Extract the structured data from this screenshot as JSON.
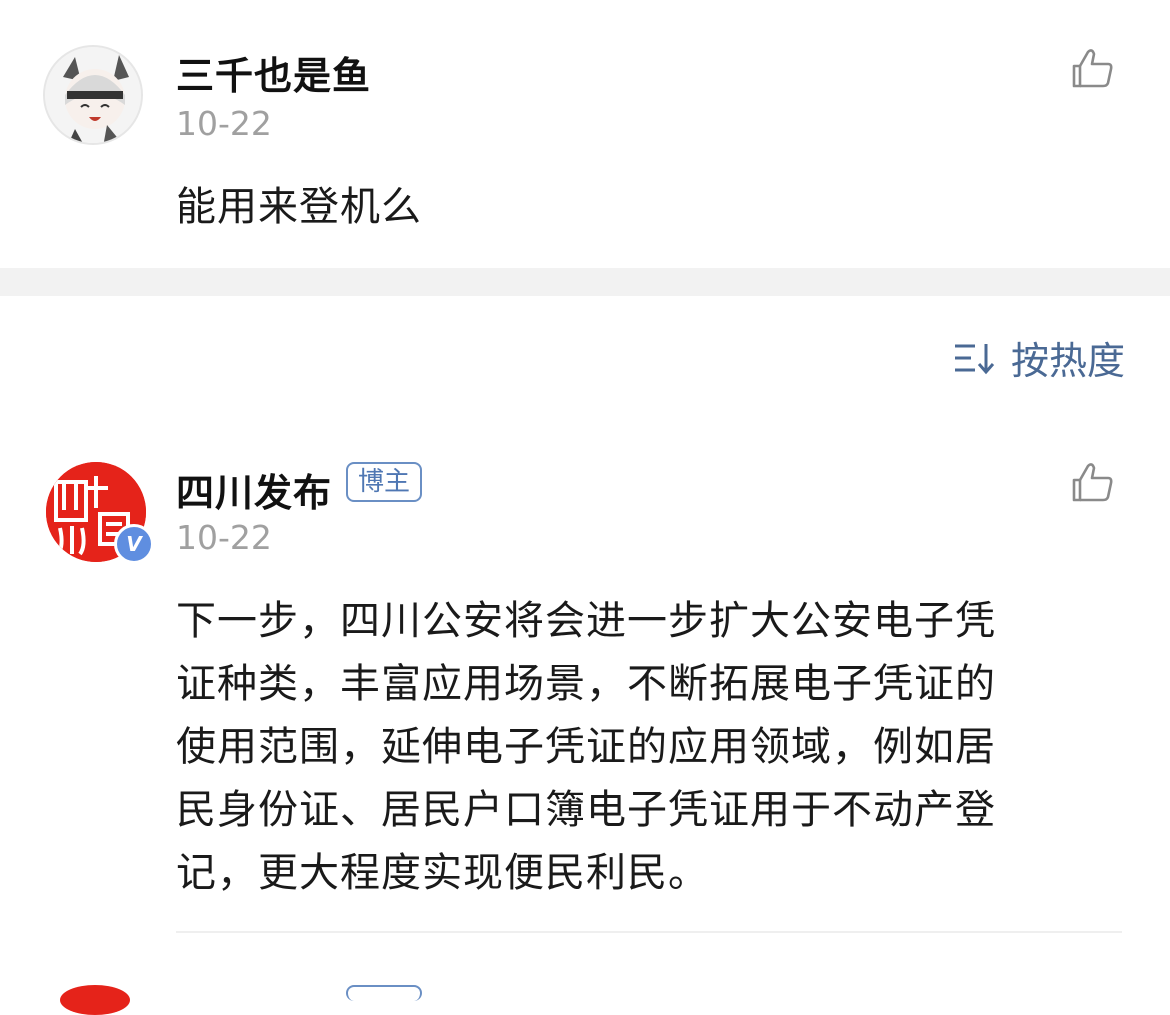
{
  "comments": [
    {
      "username": "三千也是鱼",
      "date": "10-22",
      "text": "能用来登机么"
    },
    {
      "username": "四川发布",
      "badge": "博主",
      "verified_mark": "V",
      "date": "10-22",
      "text_lines": [
        "下一步，四川公安将会进一步扩大公安电子凭",
        "证种类，丰富应用场景，不断拓展电子凭证的",
        "使用范围，延伸电子凭证的应用领域，例如居",
        "民身份证、居民户口簿电子凭证用于不动产登",
        "记，更大程度实现便民利民。"
      ]
    }
  ],
  "sort": {
    "label": "按热度",
    "icon": "sort-icon"
  },
  "colors": {
    "accent": "#4a6994",
    "divider": "#f2f2f2",
    "date": "#a0a0a0"
  }
}
